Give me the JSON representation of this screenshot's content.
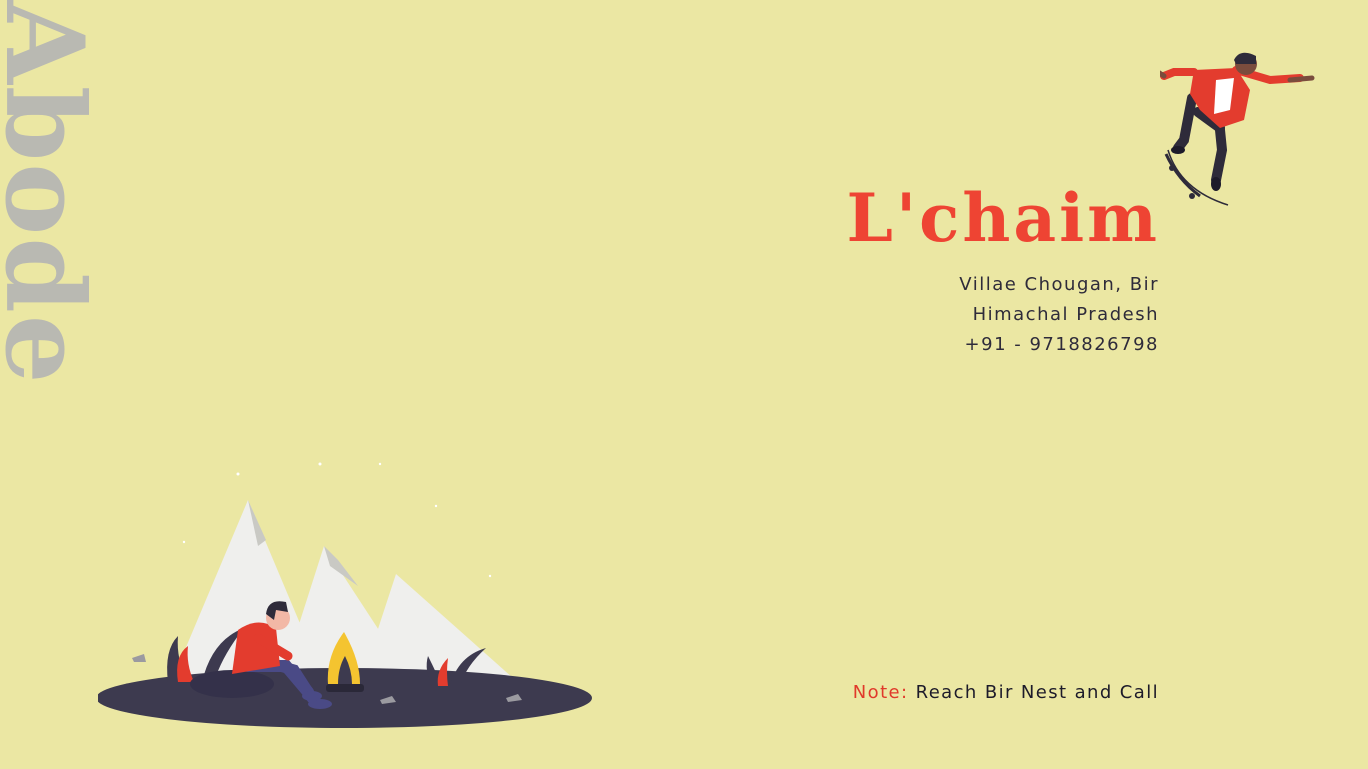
{
  "side_title": "Abode",
  "brand": {
    "name": "L'chaim"
  },
  "address": {
    "line1": "Villae Chougan, Bir",
    "line2": "Himachal Pradesh",
    "phone": "+91 - 9718826798"
  },
  "note": {
    "label": "Note:",
    "text": "Reach Bir Nest and Call"
  },
  "colors": {
    "background": "#ebe7a3",
    "accent": "#ee4433",
    "side_title": "#b9b9b2",
    "text_dark": "#2e2b3a"
  },
  "illustrations": {
    "skater": "skateboarder-illustration",
    "camp": "campfire-mountains-illustration"
  }
}
